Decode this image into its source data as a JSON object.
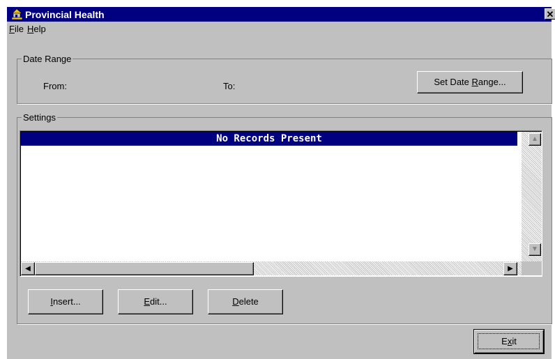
{
  "window": {
    "title": "Provincial Health",
    "close_glyph": "✕"
  },
  "menu": [
    {
      "accel": "F",
      "rest": "ile"
    },
    {
      "accel": "H",
      "rest": "elp"
    }
  ],
  "date_range": {
    "group_label": "Date Range",
    "from_label": "From:",
    "to_label": "To:",
    "set_button": {
      "pre": "Set Date ",
      "accel": "R",
      "post": "ange..."
    }
  },
  "settings": {
    "group_label": "Settings",
    "list_header": "No Records Present",
    "buttons": {
      "insert": {
        "accel": "I",
        "rest": "nsert..."
      },
      "edit": {
        "accel": "E",
        "rest": "dit..."
      },
      "delete": {
        "accel": "D",
        "rest": "elete"
      }
    }
  },
  "exit_button": {
    "pre": "E",
    "accel": "x",
    "post": "it"
  },
  "icons": {
    "app": "app-icon",
    "scroll_up": "▲",
    "scroll_down": "▼",
    "scroll_left": "◀",
    "scroll_right": "▶"
  },
  "colors": {
    "titlebar": "#000080",
    "face": "#c0c0c0",
    "list_header": "#000080"
  }
}
